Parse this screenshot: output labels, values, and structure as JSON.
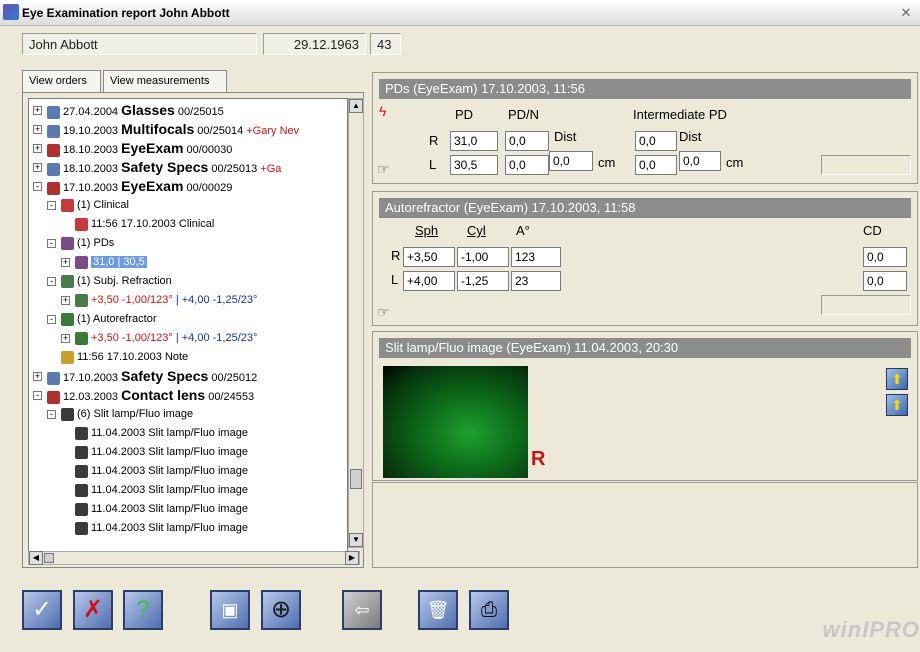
{
  "window": {
    "title": "Eye Examination report John Abbott"
  },
  "header": {
    "name": "John Abbott",
    "dob": "29.12.1963",
    "age": "43"
  },
  "tabs": [
    {
      "label": "View orders"
    },
    {
      "label": "View measurements"
    }
  ],
  "tree": [
    {
      "icon": "glasses-icon",
      "text": "27.04.2004 ",
      "bold": "Glasses",
      "suffix": " 00/25015",
      "tail": "",
      "extra": ""
    },
    {
      "icon": "glasses-icon",
      "text": "19.10.2003 ",
      "bold": "Multifocals",
      "suffix": " 00/25014 ",
      "tail": "",
      "extra": "+Gary Nev"
    },
    {
      "icon": "exam-icon",
      "text": "18.10.2003 ",
      "bold": "EyeExam",
      "suffix": " 00/00030",
      "tail": "",
      "extra": ""
    },
    {
      "icon": "glasses-icon",
      "text": "18.10.2003 ",
      "bold": "Safety Specs",
      "suffix": " 00/25013 ",
      "tail": "",
      "extra": "+Ga"
    },
    {
      "icon": "exam-icon",
      "text": "17.10.2003 ",
      "bold": "EyeExam",
      "suffix": " 00/00029",
      "tail": "",
      "extra": ""
    },
    {
      "icon": "clinical-icon",
      "text": "(1) Clinical",
      "bold": "",
      "suffix": "",
      "tail": "",
      "extra": ""
    },
    {
      "icon": "clinical-icon",
      "text": "11:56 17.10.2003 Clinical",
      "bold": "",
      "suffix": "",
      "tail": "",
      "extra": ""
    },
    {
      "icon": "pd-icon",
      "text": "(1) PDs",
      "bold": "",
      "suffix": "",
      "tail": "",
      "extra": ""
    },
    {
      "icon": "pd-icon",
      "text": "",
      "bold": "",
      "suffix": "",
      "tail": "31,0 | 30,5",
      "extra": ""
    },
    {
      "icon": "refraction-icon",
      "text": "(1) Subj. Refraction",
      "bold": "",
      "suffix": "",
      "tail": "",
      "extra": ""
    },
    {
      "icon": "refraction-icon",
      "text": "",
      "bold": "",
      "suffix": "",
      "tail": "",
      "extra": "",
      "rx_red": "+3,50 -1,00/123°",
      "rx_blue": " | +4,00 -1,25/23°"
    },
    {
      "icon": "autoref-icon",
      "text": "(1) Autorefractor",
      "bold": "",
      "suffix": "",
      "tail": "",
      "extra": ""
    },
    {
      "icon": "autoref-icon",
      "text": "",
      "bold": "",
      "suffix": "",
      "tail": "",
      "extra": "",
      "rx_red": "+3,50 -1,00/123°",
      "rx_blue": " | +4,00 -1,25/23°"
    },
    {
      "icon": "note-icon",
      "text": "11:56 17.10.2003 Note",
      "bold": "",
      "suffix": "",
      "tail": "",
      "extra": ""
    },
    {
      "icon": "glasses-icon",
      "text": "17.10.2003 ",
      "bold": "Safety Specs",
      "suffix": " 00/25012",
      "tail": "",
      "extra": ""
    },
    {
      "icon": "exam-icon",
      "text": "12.03.2003 ",
      "bold": "Contact lens",
      "suffix": " 00/24553",
      "tail": "",
      "extra": ""
    },
    {
      "icon": "slit-icon",
      "text": "(6) Slit lamp/Fluo image",
      "bold": "",
      "suffix": "",
      "tail": "",
      "extra": ""
    },
    {
      "icon": "slit-icon",
      "text": "11.04.2003 Slit lamp/Fluo image",
      "bold": "",
      "suffix": "",
      "tail": "",
      "extra": ""
    },
    {
      "icon": "slit-icon",
      "text": "11.04.2003 Slit lamp/Fluo image",
      "bold": "",
      "suffix": "",
      "tail": "",
      "extra": ""
    },
    {
      "icon": "slit-icon",
      "text": "11.04.2003 Slit lamp/Fluo image",
      "bold": "",
      "suffix": "",
      "tail": "",
      "extra": ""
    },
    {
      "icon": "slit-icon",
      "text": "11.04.2003 Slit lamp/Fluo image",
      "bold": "",
      "suffix": "",
      "tail": "",
      "extra": ""
    },
    {
      "icon": "slit-icon",
      "text": "11.04.2003 Slit lamp/Fluo image",
      "bold": "",
      "suffix": "",
      "tail": "",
      "extra": ""
    },
    {
      "icon": "slit-icon",
      "text": "11.04.2003 Slit lamp/Fluo image",
      "bold": "",
      "suffix": "",
      "tail": "",
      "extra": ""
    }
  ],
  "pds": {
    "title": "PDs (EyeExam) 17.10.2003, 11:56",
    "col_pd": "PD",
    "col_pdn": "PD/N",
    "col_int": "Intermediate PD",
    "r_label": "R",
    "l_label": "L",
    "r_pd": "31,0",
    "r_pdn": "0,0",
    "r_dist_label": "Dist",
    "l_pd": "30,5",
    "l_pdn": "0,0",
    "l_dist": "0,0",
    "cm": "cm",
    "int_r": "0,0",
    "int_dist_label": "Dist",
    "int_l": "0,0",
    "int_l_dist": "0,0",
    "int_cm": "cm"
  },
  "autoref": {
    "title": "Autorefractor (EyeExam) 17.10.2003, 11:58",
    "sph": "Sph",
    "cyl": "Cyl",
    "axis": "A°",
    "cd": "CD",
    "r_label": "R",
    "l_label": "L",
    "r_sph": "+3,50",
    "r_cyl": "-1,00",
    "r_axis": "123",
    "r_cd": "0,0",
    "l_sph": "+4,00",
    "l_cyl": "-1,25",
    "l_axis": "23",
    "l_cd": "0,0"
  },
  "slit": {
    "title": "Slit lamp/Fluo image (EyeExam) 11.04.2003, 20:30",
    "eye": "R"
  },
  "toolbar": {
    "ok": "✓",
    "cancel": "✗",
    "help": "?",
    "b4": "▣",
    "b5": "⊕",
    "b6": "⇦",
    "b7": "🗑",
    "b8": "⎙"
  },
  "brand": "winIPRO",
  "colors": {
    "accent": "#d01010",
    "panel_title": "#8c8c8c",
    "highlight": "#6a9be6"
  }
}
